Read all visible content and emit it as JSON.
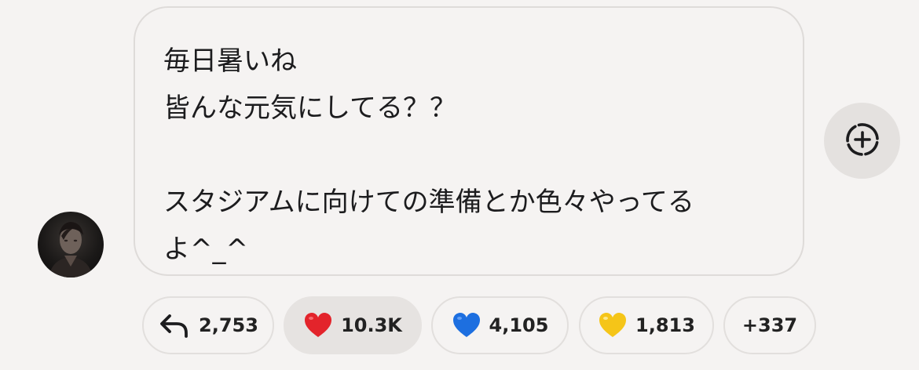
{
  "message": {
    "lines": [
      "毎日暑いね",
      "皆んな元気にしてる？？",
      "",
      "スタジアムに向けての準備とか色々やってる",
      "よ^_^"
    ]
  },
  "reactions": {
    "reply": {
      "icon": "reply-arrow-icon",
      "count": "2,753"
    },
    "red_heart": {
      "icon": "red-heart-icon",
      "color": "#e3242b",
      "count": "10.3K",
      "selected": true
    },
    "blue_heart": {
      "icon": "blue-heart-icon",
      "color": "#1d6fe0",
      "count": "4,105"
    },
    "yellow_heart": {
      "icon": "yellow-heart-icon",
      "color": "#f5c518",
      "count": "1,813"
    },
    "more": {
      "label": "+337"
    }
  },
  "add_reaction": {
    "icon": "add-reaction-icon"
  },
  "avatar": {
    "icon": "user-avatar"
  }
}
